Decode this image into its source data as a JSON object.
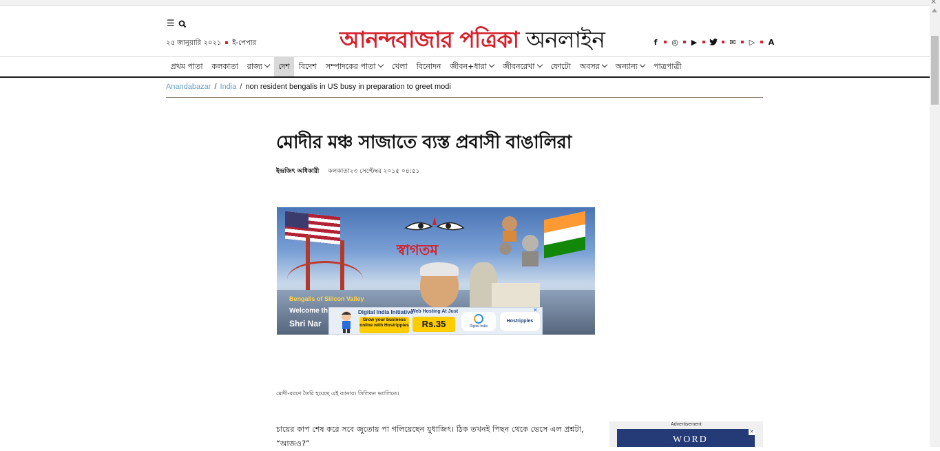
{
  "browser": {
    "close_glyph": "✕"
  },
  "header": {
    "date": "২৫ জানুয়ারি ২০২১",
    "epaper_label": "ই-পেপার",
    "logo_red": "আনন্দবাজার পত্রিকা",
    "logo_black": "অনলাইন",
    "social_icons": [
      "facebook-icon",
      "instagram-icon",
      "youtube-icon",
      "twitter-icon",
      "email-icon",
      "google-play-icon",
      "app-icon"
    ],
    "social_glyphs": [
      "f",
      "◎",
      "▶",
      "🐦",
      "✉",
      "▷",
      "A"
    ]
  },
  "nav": {
    "items": [
      {
        "label": "প্রথম পাতা",
        "dropdown": false,
        "active": false
      },
      {
        "label": "কলকাতা",
        "dropdown": false,
        "active": false
      },
      {
        "label": "রাজ্য",
        "dropdown": true,
        "active": false
      },
      {
        "label": "দেশ",
        "dropdown": false,
        "active": true
      },
      {
        "label": "বিদেশ",
        "dropdown": false,
        "active": false
      },
      {
        "label": "সম্পাদকের পাতা",
        "dropdown": true,
        "active": false
      },
      {
        "label": "খেলা",
        "dropdown": false,
        "active": false
      },
      {
        "label": "বিনোদন",
        "dropdown": false,
        "active": false
      },
      {
        "label": "জীবন+ধারা",
        "dropdown": true,
        "active": false
      },
      {
        "label": "জীবনরেখা",
        "dropdown": true,
        "active": false
      },
      {
        "label": "ফোটো",
        "dropdown": false,
        "active": false
      },
      {
        "label": "অবসর",
        "dropdown": true,
        "active": false
      },
      {
        "label": "অন্যান্য",
        "dropdown": true,
        "active": false
      },
      {
        "label": "পাত্রপাত্রী",
        "dropdown": false,
        "active": false
      }
    ]
  },
  "breadcrumb": {
    "home": "Anandabazar",
    "section": "India",
    "current": "non resident bengalis in US busy in preparation to greet modi",
    "separator": "/"
  },
  "article": {
    "headline": "মোদীর মঞ্চ সাজাতে ব্যস্ত প্রবাসী বাঙালিরা",
    "author": "ইন্দ্রজিৎ অধিকারী",
    "place_date": "কলকাতা২৩ সেপ্টেম্বর ২০১৫ ০৪:৫১",
    "image": {
      "welcome_bn": "স্বাগতম",
      "silicon_valley": "Bengalis of Silicon Valley",
      "welcome_en": "Welcome th",
      "shri_nam": "Shri Nar"
    },
    "caption": "মোদী-বরণে তৈরি হয়েছে এই ব্যানার। সিলিকন ভ্যালিতে।",
    "paragraph": "চায়ের কাপ শেষ করে সবে জুতোয় পা গলিয়েছেন যুধাজিৎ। ঠিক তখনই পিছন থেকে ভেসে এল প্রশ্নটা, “আজও?”"
  },
  "inline_ad": {
    "title": "Digital India Initiative",
    "text": "Grow your business online with Hostripples",
    "hosting": "Web Hosting At Just",
    "price": "Rs.35",
    "logo1": "Digital India",
    "logo2": "Hostripples",
    "close_glyph": "✕"
  },
  "side_ad": {
    "label": "Advertisement",
    "word": "WORD",
    "close_glyph": "✕"
  },
  "colors": {
    "brand_red": "#d6202b",
    "link_blue": "#6a9ec4",
    "nav_active_bg": "#d9d9d9"
  }
}
